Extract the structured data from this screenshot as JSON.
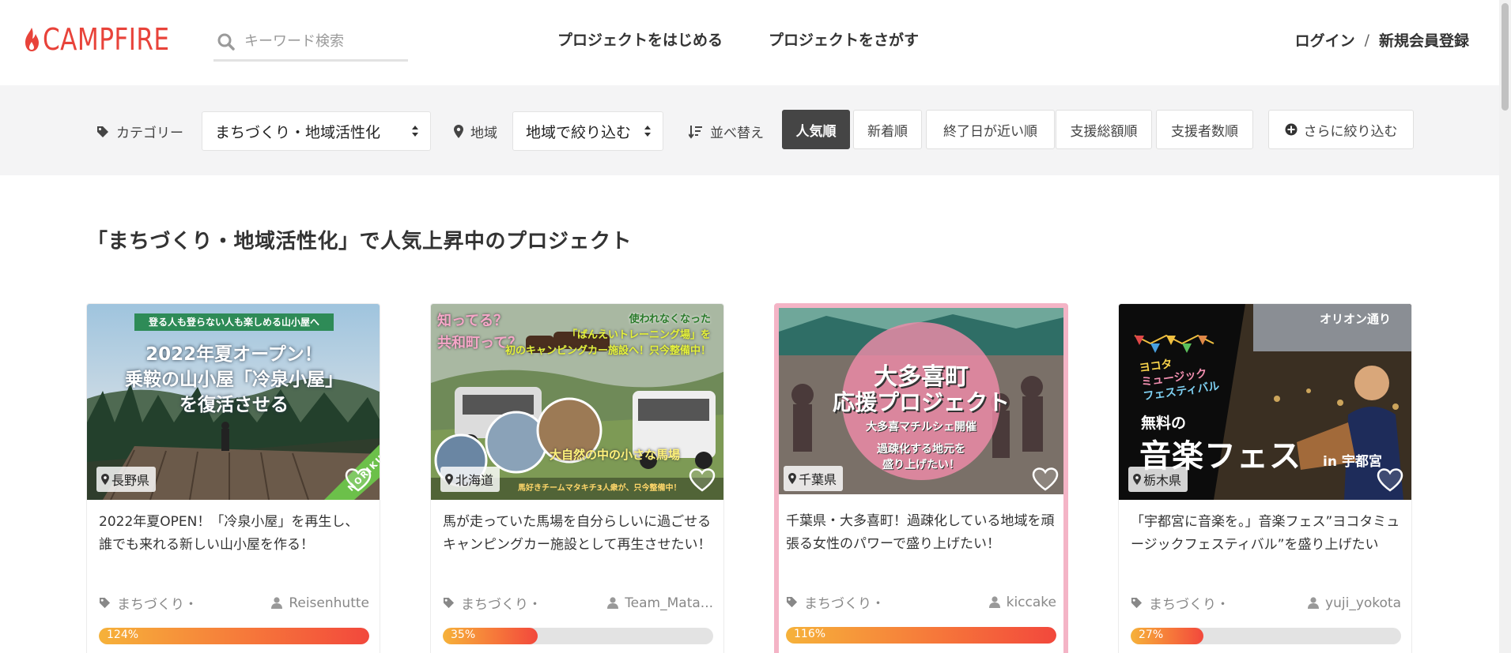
{
  "header": {
    "logo_text": "CAMPFIRE",
    "search_placeholder": "キーワード検索",
    "nav": [
      "プロジェクトをはじめる",
      "プロジェクトをさがす"
    ],
    "login": "ログイン",
    "separator": "/",
    "signup": "新規会員登録"
  },
  "filters": {
    "category_label": "カテゴリー",
    "category_value": "まちづくり・地域活性化",
    "region_label": "地域",
    "region_value": "地域で絞り込む",
    "sort_label": "並べ替え",
    "sort_options": [
      "人気順",
      "新着順",
      "終了日が近い順",
      "支援総額順",
      "支援者数順"
    ],
    "sort_active": "人気順",
    "more_label": "さらに絞り込む"
  },
  "section_title": "「まちづくり・地域活性化」で人気上昇中のプロジェクト",
  "cards": [
    {
      "image_lines": [
        "登る人も登らない人も楽しめる山小屋へ",
        "2022年夏オープン！",
        "乗鞍の山小屋「冷泉小屋」",
        "を復活させる"
      ],
      "image_brand": "NORIKURA",
      "location": "長野県",
      "title": "2022年夏OPEN！「冷泉小屋」を再生し、誰でも来れる新しい山小屋を作る！",
      "category": "まちづくり・",
      "owner": "Reisenhutte",
      "progress_label": "124%",
      "progress": 1.24
    },
    {
      "image_lines": [
        "知ってる？",
        "共和町って？",
        "使われなくなった",
        "「ばんえいトレーニング場」を",
        "初のキャンピングカー施設へ！只今整備中！",
        "大自然の中の小さな馬場",
        "馬好きチームマタキチ3人衆が、只今整備中！"
      ],
      "location": "北海道",
      "title": "馬が走っていた馬場を自分らしいに過ごせるキャンピングカー施設として再生させたい！",
      "category": "まちづくり・",
      "owner": "Team_Mata...",
      "progress_label": "35%",
      "progress": 0.35
    },
    {
      "image_lines": [
        "大多喜町",
        "応援プロジェクト",
        "大多喜マチルシェ開催",
        "過疎化する地元を",
        "盛り上げたい！"
      ],
      "location": "千葉県",
      "title": "千葉県・大多喜町！過疎化している地域を頑張る女性のパワーで盛り上げたい！",
      "category": "まちづくり・",
      "owner": "kiccake",
      "progress_label": "116%",
      "progress": 1.16
    },
    {
      "image_lines": [
        "ヨコタ",
        "ミュージック",
        "フェスティバル",
        "オリオン通り",
        "無料の",
        "音楽フェス",
        "in 宇都宮"
      ],
      "location": "栃木県",
      "title": "「宇都宮に音楽を。」音楽フェス”ヨコタミュージックフェスティバル”を盛り上げたい",
      "category": "まちづくり・",
      "owner": "yuji_yokota",
      "progress_label": "27%",
      "progress": 0.27
    }
  ],
  "colors": {
    "brand": "#e8433a",
    "active_sort": "#454545",
    "progress_start": "#f6b23a",
    "progress_end": "#f2483c"
  },
  "icons": [
    "campfire-logo-icon",
    "search-icon",
    "tag-icon",
    "map-pin-icon",
    "sort-icon",
    "plus-circle-icon",
    "heart-icon",
    "user-icon"
  ]
}
